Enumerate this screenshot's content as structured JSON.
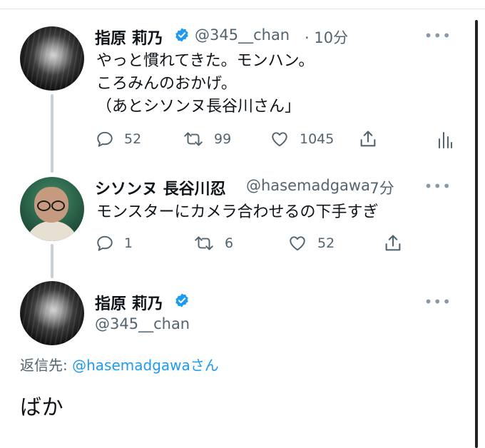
{
  "colors": {
    "accent": "#1d9bf0",
    "muted": "#536471",
    "text": "#0f1419",
    "thread": "#c8cfd5"
  },
  "tweets": [
    {
      "name": "指原 莉乃",
      "handle": "@345__chan",
      "time": "· 10分",
      "lines": [
        "やっと慣れてきた。モンハン。",
        "ころみんのおかげ。",
        "（あとシソンヌ長谷川さん」"
      ],
      "actions": {
        "replies": "52",
        "retweets": "99",
        "likes": "1045"
      },
      "verified": true,
      "avatar": "dark-portrait"
    },
    {
      "name": "シソンヌ 長谷川忍",
      "handle": "@hasemadgawa",
      "time": "· 7分",
      "lines": [
        "モンスターにカメラ合わせるの下手すぎ"
      ],
      "actions": {
        "replies": "1",
        "retweets": "6",
        "likes": "52"
      },
      "avatar": "man-with-glasses"
    }
  ],
  "focused": {
    "name": "指原 莉乃",
    "handle": "@345__chan",
    "verified": true,
    "reply_label": "返信先:",
    "reply_mention": "@hasemadgawa",
    "reply_suffix": "さん",
    "text": "ばか"
  },
  "more_label": "•••",
  "icons": [
    "reply-icon",
    "retweet-icon",
    "like-icon",
    "share-icon",
    "analytics-icon",
    "verified-icon",
    "more-icon"
  ]
}
